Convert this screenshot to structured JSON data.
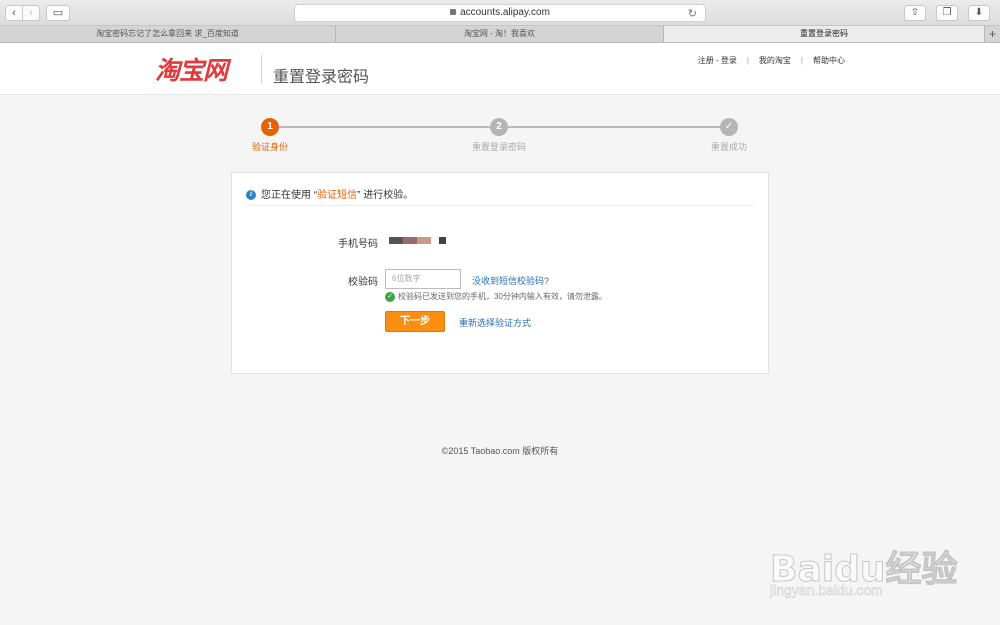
{
  "browser": {
    "url": "accounts.alipay.com",
    "tabs": [
      {
        "label": "淘宝密码忘记了怎么拿回来 求_百度知道",
        "active": false
      },
      {
        "label": "淘宝网 - 淘！我喜欢",
        "active": false
      },
      {
        "label": "重置登录密码",
        "active": true
      }
    ]
  },
  "header": {
    "logo": "淘宝网",
    "title": "重置登录密码",
    "links": [
      "注册 - 登录",
      "我的淘宝",
      "帮助中心"
    ]
  },
  "steps": [
    {
      "number": "1",
      "label": "验证身份",
      "state": "active"
    },
    {
      "number": "2",
      "label": "重置登录密码",
      "state": "pending"
    },
    {
      "number": "✓",
      "label": "重置成功",
      "state": "pending"
    }
  ],
  "form": {
    "notice_prefix": "您正在使用 “",
    "notice_method": "验证短信",
    "notice_suffix": "” 进行校验。",
    "phone_label": "手机号码",
    "code_label": "校验码",
    "code_placeholder": "6位数字",
    "resend_link": "没收到短信校验码?",
    "sent_message": "校验码已发送到您的手机，30分钟内输入有效，请勿泄露。",
    "next_button": "下一步",
    "reselect_link": "重新选择验证方式"
  },
  "footer": {
    "copyright": "©2015 Taobao.com 版权所有"
  },
  "watermark": {
    "brand": "Baidu经验",
    "url": "jingyan.baidu.com"
  },
  "colors": {
    "accent": "#e66100",
    "brand_red": "#e4393c",
    "link": "#2a6eb8",
    "button": "#f98e10"
  }
}
